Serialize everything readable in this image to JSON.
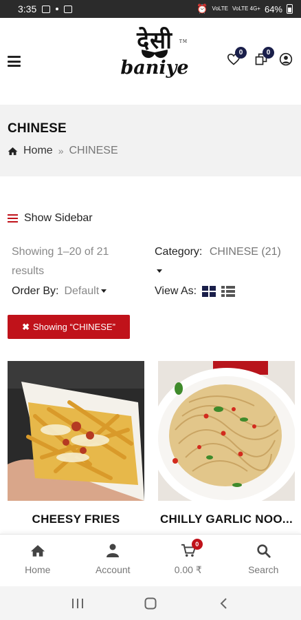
{
  "status_bar": {
    "time": "3:35",
    "signal1": "VoLTE",
    "signal2": "VoLTE 4G+",
    "battery": "64%"
  },
  "header": {
    "logo_top": "देसी",
    "logo_tm": "TM",
    "logo_bottom": "baniye",
    "wishlist_count": "0",
    "compare_count": "0"
  },
  "page": {
    "title": "CHINESE",
    "breadcrumb": {
      "home": "Home",
      "separator": "»",
      "current": "CHINESE"
    }
  },
  "toolbar": {
    "show_sidebar": "Show Sidebar",
    "results_text": "Showing 1–20 of 21 results",
    "category_label": "Category:",
    "category_value": "CHINESE (21)",
    "order_label": "Order By:",
    "order_value": "Default",
    "view_label": "View As:",
    "filter_chip": "Showing “CHINESE”"
  },
  "products": [
    {
      "name": "CHEESY FRIES"
    },
    {
      "name": "CHILLY GARLIC NOO..."
    }
  ],
  "bottom_nav": {
    "home": "Home",
    "account": "Account",
    "cart_total": "0.00 ₹",
    "cart_count": "0",
    "search": "Search"
  },
  "colors": {
    "accent": "#c0121a",
    "navy": "#1a1f4a",
    "muted": "#888888"
  }
}
